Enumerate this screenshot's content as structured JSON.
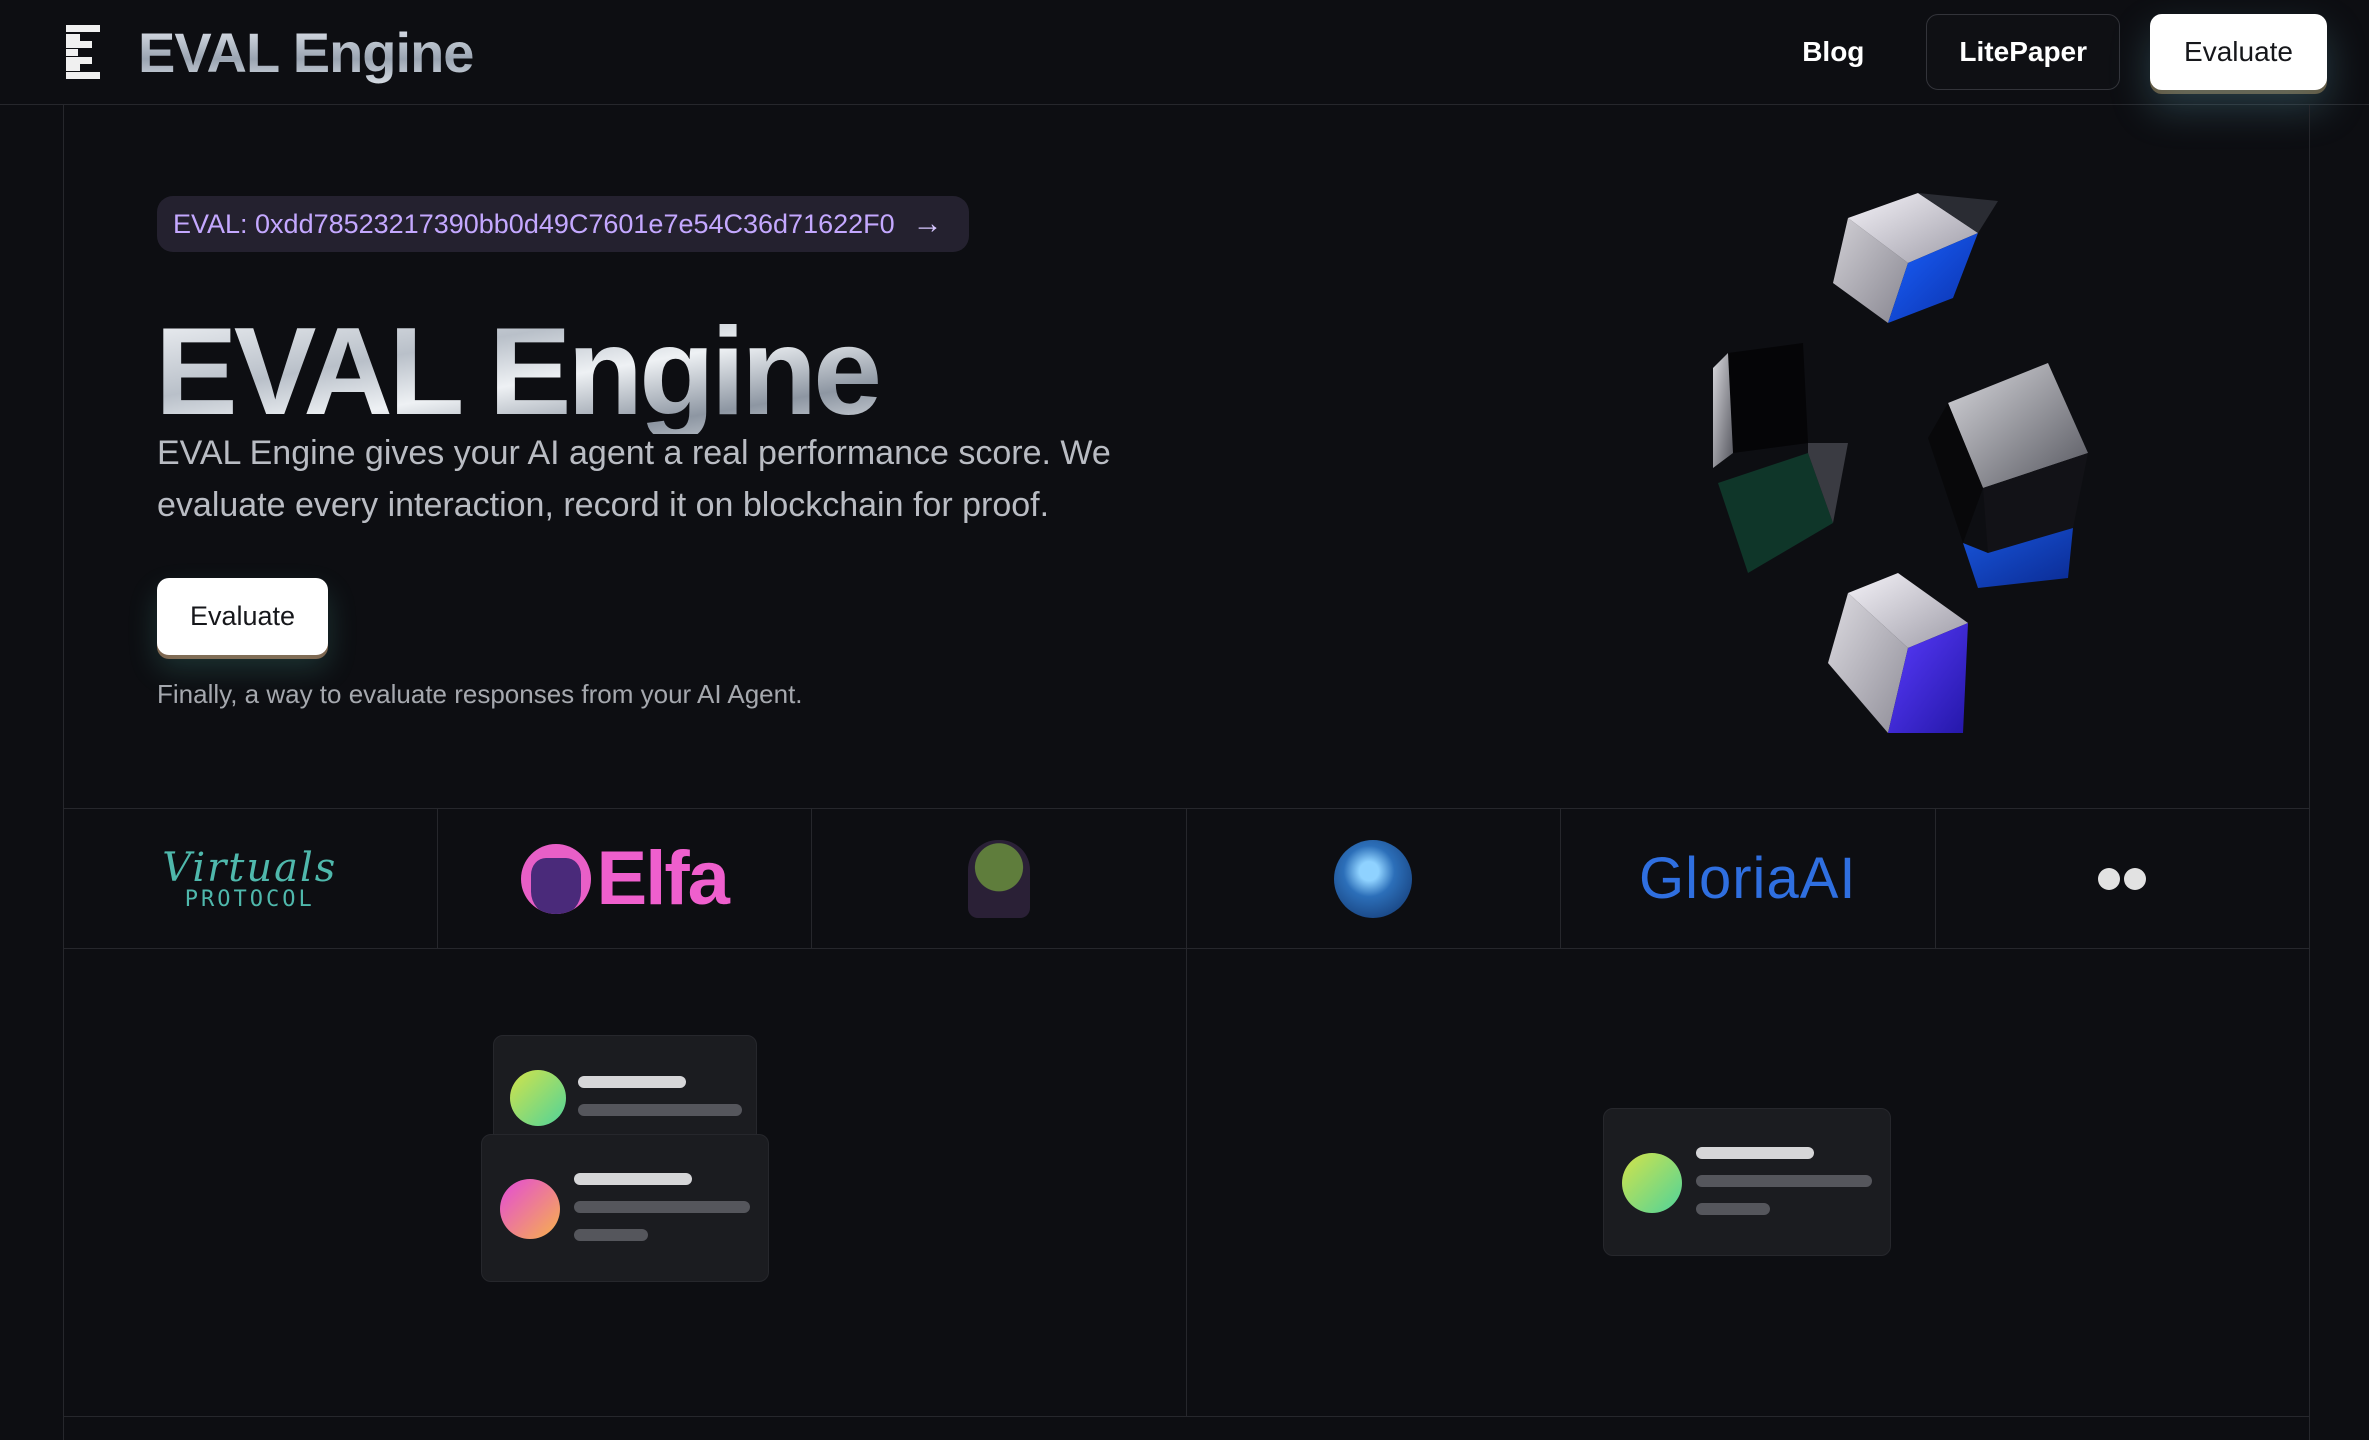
{
  "nav": {
    "brand": "EVAL Engine",
    "links": {
      "blog": "Blog",
      "litepaper": "LitePaper",
      "evaluate": "Evaluate"
    }
  },
  "hero": {
    "token": "EVAL: 0xdd78523217390bb0d49C7601e7e54C36d71622F0",
    "title": "EVAL Engine",
    "description": "EVAL Engine gives your AI agent a real performance score. We evaluate every interaction, record it on blockchain for proof.",
    "cta": "Evaluate",
    "note": "Finally, a way to evaluate responses from your AI Agent."
  },
  "partners": {
    "virtuals_script": "Virtuals",
    "virtuals_sub": "PROTOCOL",
    "elfa": "Elfa",
    "gloria": "GloriaAI"
  },
  "colors": {
    "background": "#0d0e12",
    "accent_purple": "#c4a8ff",
    "elfa_pink": "#ef5fcd",
    "gloria_blue": "#2f6fe0",
    "virtuals_teal": "#4fb8ac"
  }
}
